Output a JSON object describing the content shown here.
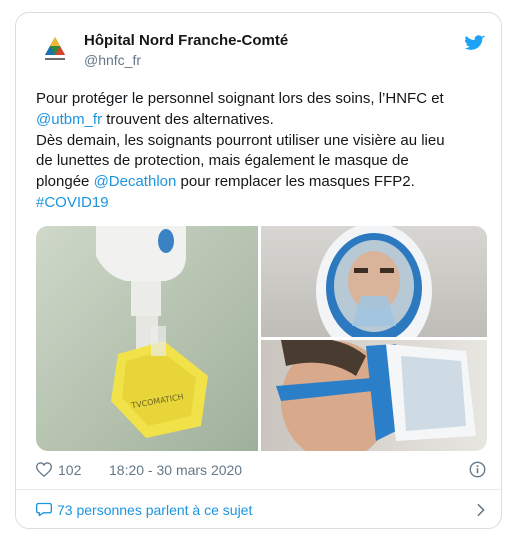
{
  "tweet": {
    "author": {
      "name": "Hôpital Nord Franche-Comté",
      "handle": "@hnfc_fr",
      "avatar_icon": "hospital-logo-icon"
    },
    "platform_icon": "twitter-bird-icon",
    "text": {
      "line1": "Pour protéger le personnel soignant lors des soins, l’HNFC et",
      "mention_utbm": "@utbm_fr",
      "line2_rest": " trouvent des alternatives.",
      "line3": "Dès demain, les soignants pourront utiliser une visière au lieu",
      "line4": "de lunettes de protection, mais également le masque de",
      "line5_start": "plongée ",
      "mention_decathlon": "@Decathlon",
      "line5_rest": " pour remplacer les masques FFP2.",
      "hashtag": "#COVID19"
    },
    "media": {
      "photos": [
        {
          "description_icon": "valve-filter-photo"
        },
        {
          "description_icon": "face-mask-front-photo"
        },
        {
          "description_icon": "face-mask-side-photo"
        }
      ]
    },
    "likes": "102",
    "timestamp": "18:20 - 30 mars 2020",
    "footer_label": "73 personnes parlent à ce sujet"
  },
  "colors": {
    "link": "#1b95e0",
    "text": "#14171a",
    "muted": "#657786",
    "border": "#d9dee2"
  }
}
